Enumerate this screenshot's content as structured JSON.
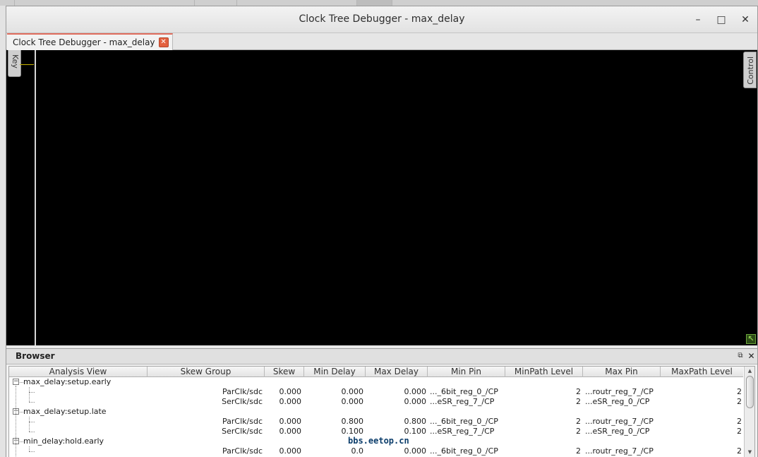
{
  "window": {
    "title": "Clock Tree Debugger - max_delay",
    "minimize_glyph": "–",
    "maximize_glyph": "□",
    "close_glyph": "✕"
  },
  "tab": {
    "label": "Clock Tree Debugger - max_delay",
    "close_glyph": "✕"
  },
  "canvas": {
    "key_label": "Key",
    "control_label": "Control",
    "resize_glyph": "↖"
  },
  "browser": {
    "title": "Browser",
    "float_glyph": "⧉",
    "close_glyph": "✕",
    "columns": [
      "Analysis View",
      "Skew Group",
      "Skew",
      "Min Delay",
      "Max Delay",
      "Min Pin",
      "MinPath Level",
      "Max Pin",
      "MaxPath Level"
    ],
    "groups": [
      {
        "name": "max_delay:setup.early",
        "expander": "−",
        "rows": [
          {
            "skew_group": "ParClk/sdc",
            "skew": "0.000",
            "min_delay": "0.000",
            "max_delay": "0.000",
            "min_pin": "..._6bit_reg_0_/CP",
            "minpath_level": "2",
            "max_pin": "...routr_reg_7_/CP",
            "maxpath_level": "2"
          },
          {
            "skew_group": "SerClk/sdc",
            "skew": "0.000",
            "min_delay": "0.000",
            "max_delay": "0.000",
            "min_pin": "...eSR_reg_7_/CP",
            "minpath_level": "2",
            "max_pin": "...eSR_reg_0_/CP",
            "maxpath_level": "2"
          }
        ]
      },
      {
        "name": "max_delay:setup.late",
        "expander": "−",
        "rows": [
          {
            "skew_group": "ParClk/sdc",
            "skew": "0.000",
            "min_delay": "0.800",
            "max_delay": "0.800",
            "min_pin": "..._6bit_reg_0_/CP",
            "minpath_level": "2",
            "max_pin": "...routr_reg_7_/CP",
            "maxpath_level": "2"
          },
          {
            "skew_group": "SerClk/sdc",
            "skew": "0.000",
            "min_delay": "0.100",
            "max_delay": "0.100",
            "min_pin": "...eSR_reg_7_/CP",
            "minpath_level": "2",
            "max_pin": "...eSR_reg_0_/CP",
            "maxpath_level": "2"
          }
        ]
      },
      {
        "name": "min_delay:hold.early",
        "expander": "−",
        "rows": [
          {
            "skew_group": "ParClk/sdc",
            "skew": "0.000",
            "min_delay": "0.0",
            "max_delay": "0.000",
            "min_pin": "..._6bit_reg_0_/CP",
            "minpath_level": "2",
            "max_pin": "...routr_reg_7_/CP",
            "maxpath_level": "2"
          }
        ]
      }
    ],
    "scroll_up_glyph": "▲",
    "scroll_down_glyph": "▼"
  },
  "watermark": "bbs.eetop.cn"
}
